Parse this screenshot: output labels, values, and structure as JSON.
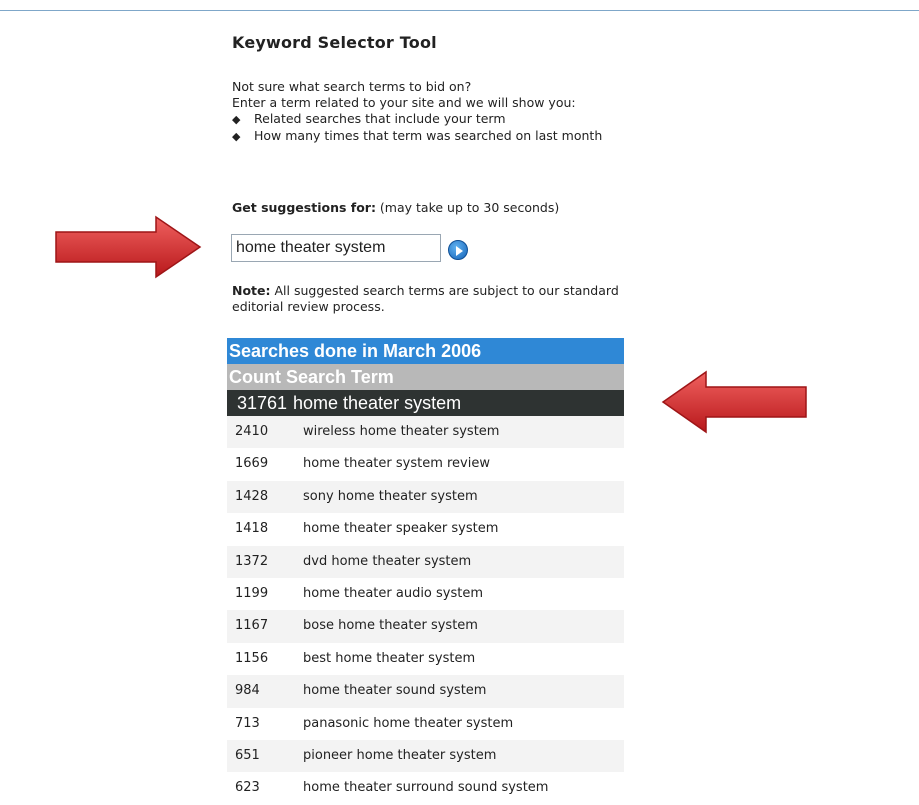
{
  "page": {
    "title": "Keyword Selector Tool"
  },
  "intro": {
    "line1": "Not sure what search terms to bid on?",
    "line2": "Enter a term related to your site and we will show you:",
    "bullets": [
      "Related searches that include your term",
      "How many times that term was searched on last month"
    ]
  },
  "suggest": {
    "label_bold": "Get suggestions for:",
    "label_rest": " (may take up to 30 seconds)",
    "input_value": "home theater system",
    "go_icon": "circle-arrow-right-icon"
  },
  "note": {
    "bold": "Note:",
    "text": " All suggested search terms are subject to our standard editorial review process."
  },
  "results": {
    "header": "Searches done in March 2006",
    "col_count": "Count",
    "col_term": "Search Term",
    "top": {
      "count": "31761",
      "term": "home theater system"
    },
    "rows": [
      {
        "count": "2410",
        "term": "wireless home theater system"
      },
      {
        "count": "1669",
        "term": "home theater system review"
      },
      {
        "count": "1428",
        "term": "sony home theater system"
      },
      {
        "count": "1418",
        "term": "home theater speaker system"
      },
      {
        "count": "1372",
        "term": "dvd home theater system"
      },
      {
        "count": "1199",
        "term": "home theater audio system"
      },
      {
        "count": "1167",
        "term": "bose home theater system"
      },
      {
        "count": "1156",
        "term": "best home theater system"
      },
      {
        "count": "984",
        "term": "home theater sound system"
      },
      {
        "count": "713",
        "term": "panasonic home theater system"
      },
      {
        "count": "651",
        "term": "pioneer home theater system"
      },
      {
        "count": "623",
        "term": "home theater surround sound system"
      }
    ]
  },
  "annotations": {
    "arrow_color": "#d9292b",
    "left_arrow_icon": "red-arrow-right-icon",
    "right_arrow_icon": "red-arrow-left-icon"
  }
}
